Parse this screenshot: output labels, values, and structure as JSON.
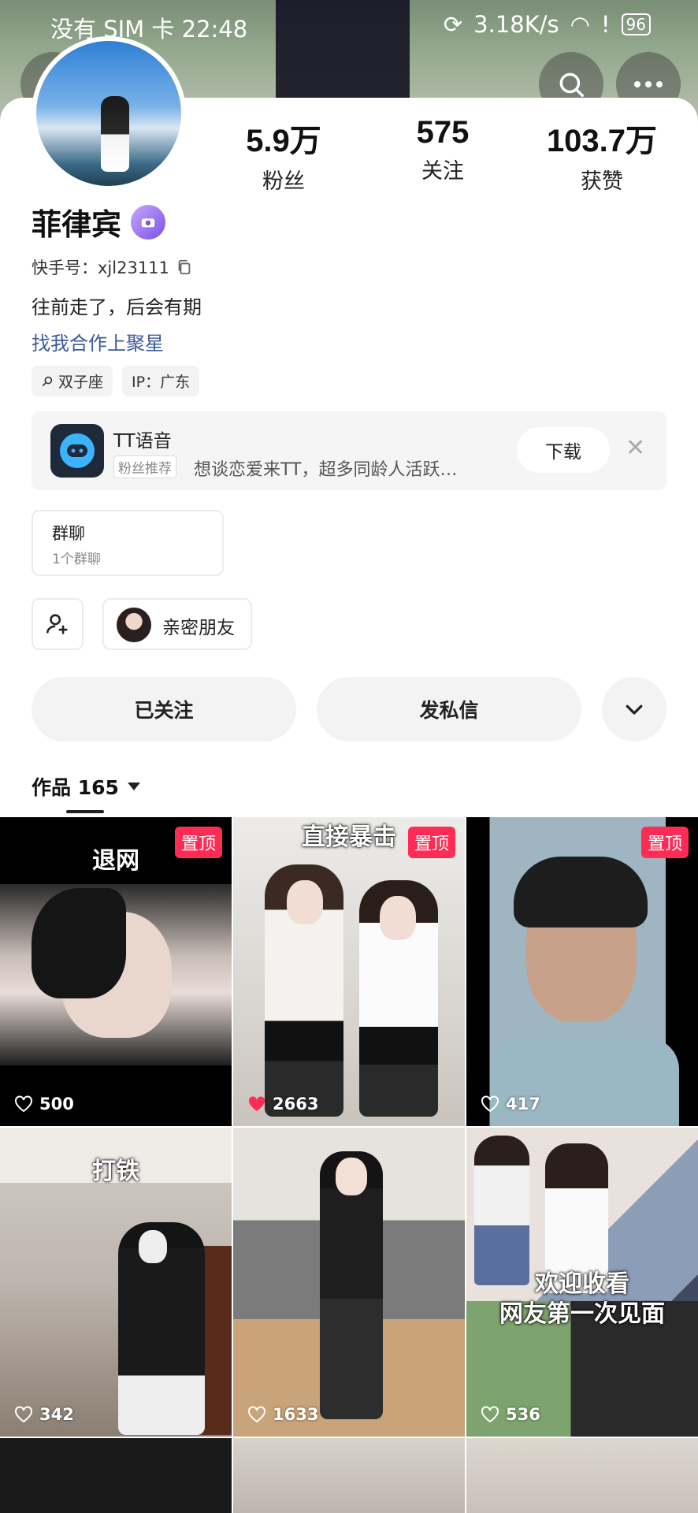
{
  "status_bar": {
    "left": "没有 SIM 卡 22:48",
    "speed": "3.18K/s",
    "battery": "96"
  },
  "profile": {
    "name": "菲律宾",
    "kuaishou_id": "快手号：xjl23111",
    "bio": "往前走了，后会有期",
    "cooperation_link": "找我合作上聚星",
    "tags": [
      "双子座",
      "IP：广东"
    ]
  },
  "stats": [
    {
      "value": "5.9万",
      "label": "粉丝"
    },
    {
      "value": "575",
      "label": "关注"
    },
    {
      "value": "103.7万",
      "label": "获赞"
    }
  ],
  "ad": {
    "app": "TT语音",
    "pill": "粉丝推荐",
    "desc": "想谈恋爱来TT，超多同龄人活跃…",
    "download": "下载"
  },
  "group_chat": {
    "title": "群聊",
    "sub": "1个群聊"
  },
  "intimate_friend": "亲密朋友",
  "actions": {
    "following": "已关注",
    "message": "发私信"
  },
  "works_label": "作品 165",
  "videos": [
    {
      "caption": "退网",
      "pinned": "置顶",
      "likes": "500",
      "liked": false
    },
    {
      "caption": "直接暴击",
      "pinned": "置顶",
      "likes": "2663",
      "liked": true
    },
    {
      "caption": "",
      "pinned": "置顶",
      "likes": "417",
      "liked": false
    },
    {
      "caption": "打铁",
      "pinned": "",
      "likes": "342",
      "liked": false
    },
    {
      "caption": "",
      "pinned": "",
      "likes": "1633",
      "liked": false
    },
    {
      "caption": "欢迎收看\n网友第一次见面",
      "pinned": "",
      "likes": "536",
      "liked": false
    }
  ],
  "colors": {
    "pin": "#fe2c55",
    "link": "#3d5a9a"
  }
}
